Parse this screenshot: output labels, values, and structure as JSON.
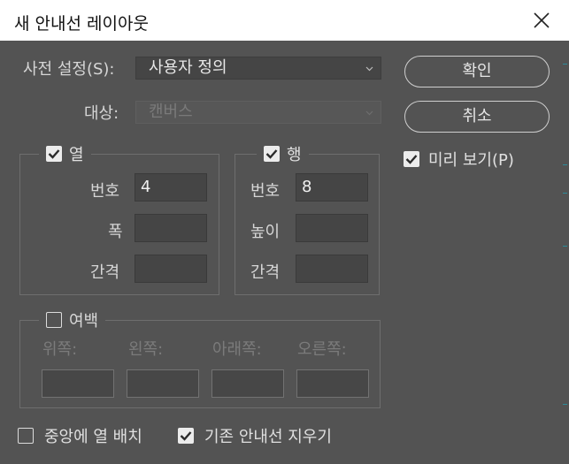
{
  "window": {
    "title": "새 안내선 레이아웃"
  },
  "preset": {
    "label": "사전 설정(S):",
    "value": "사용자 정의"
  },
  "target": {
    "label": "대상:",
    "value": "캔버스"
  },
  "buttons": {
    "ok": "확인",
    "cancel": "취소"
  },
  "preview": {
    "label": "미리 보기(P)",
    "checked": true
  },
  "columns": {
    "legend": "열",
    "checked": true,
    "number_label": "번호",
    "number_value": "4",
    "width_label": "폭",
    "width_value": "",
    "gutter_label": "간격",
    "gutter_value": ""
  },
  "rows": {
    "legend": "행",
    "checked": true,
    "number_label": "번호",
    "number_value": "8",
    "height_label": "높이",
    "height_value": "",
    "gutter_label": "간격",
    "gutter_value": ""
  },
  "margin": {
    "legend": "여백",
    "checked": false,
    "top_label": "위쪽:",
    "left_label": "왼쪽:",
    "bottom_label": "아래쪽:",
    "right_label": "오른쪽:",
    "top_value": "",
    "left_value": "",
    "bottom_value": "",
    "right_value": ""
  },
  "options": {
    "center_columns": {
      "label": "중앙에 열 배치",
      "checked": false
    },
    "clear_existing": {
      "label": "기존 안내선 지우기",
      "checked": true
    }
  },
  "colors": {
    "panel": "#535353",
    "field": "#454545",
    "titlebar": "#ffffff",
    "guide_edge": "#2c8c9a"
  }
}
